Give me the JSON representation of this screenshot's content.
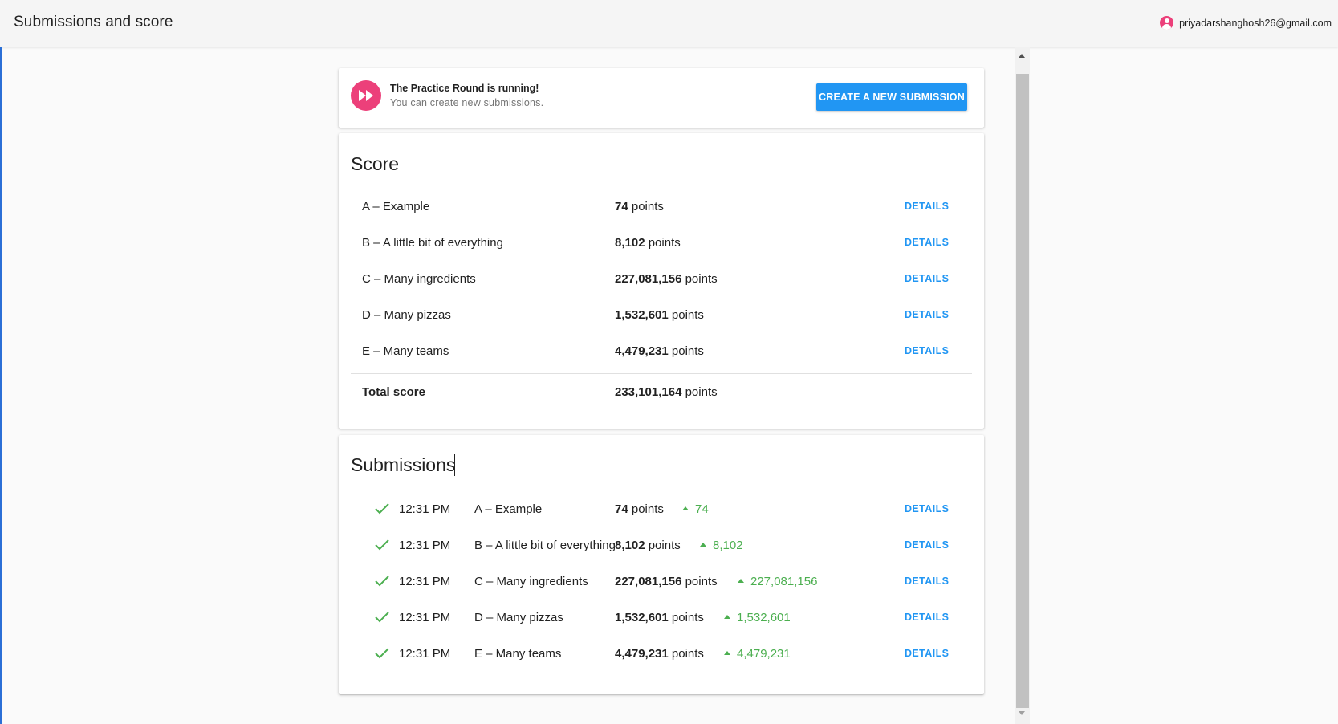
{
  "header": {
    "title": "Submissions and score",
    "account_email": "priyadarshanghosh26@gmail.com",
    "account_icon": "account-circle-icon"
  },
  "round": {
    "icon": "fast-forward-icon",
    "title": "The Practice Round is running!",
    "subtitle": "You can create new submissions.",
    "button_label": "CREATE A NEW SUBMISSION"
  },
  "score": {
    "title": "Score",
    "rows": [
      {
        "name": "A – Example",
        "points": "74",
        "unit": "points",
        "action": "DETAILS"
      },
      {
        "name": "B – A little bit of everything",
        "points": "8,102",
        "unit": "points",
        "action": "DETAILS"
      },
      {
        "name": "C – Many ingredients",
        "points": "227,081,156",
        "unit": "points",
        "action": "DETAILS"
      },
      {
        "name": "D – Many pizzas",
        "points": "1,532,601",
        "unit": "points",
        "action": "DETAILS"
      },
      {
        "name": "E – Many teams",
        "points": "4,479,231",
        "unit": "points",
        "action": "DETAILS"
      }
    ],
    "total": {
      "label": "Total score",
      "points": "233,101,164",
      "unit": "points"
    }
  },
  "submissions": {
    "title": "Submissions",
    "rows": [
      {
        "time": "12:31 PM",
        "name": "A – Example",
        "points": "74",
        "unit": "points",
        "delta": "74",
        "action": "DETAILS"
      },
      {
        "time": "12:31 PM",
        "name": "B – A little bit of everything",
        "points": "8,102",
        "unit": "points",
        "delta": "8,102",
        "action": "DETAILS"
      },
      {
        "time": "12:31 PM",
        "name": "C – Many ingredients",
        "points": "227,081,156",
        "unit": "points",
        "delta": "227,081,156",
        "action": "DETAILS"
      },
      {
        "time": "12:31 PM",
        "name": "D – Many pizzas",
        "points": "1,532,601",
        "unit": "points",
        "delta": "1,532,601",
        "action": "DETAILS"
      },
      {
        "time": "12:31 PM",
        "name": "E – Many teams",
        "points": "4,479,231",
        "unit": "points",
        "delta": "4,479,231",
        "action": "DETAILS"
      }
    ]
  },
  "colors": {
    "accent": "#2196f3",
    "brand_pink": "#ec407a",
    "success": "#4caf50",
    "left_edge": "#2b6fd6"
  }
}
